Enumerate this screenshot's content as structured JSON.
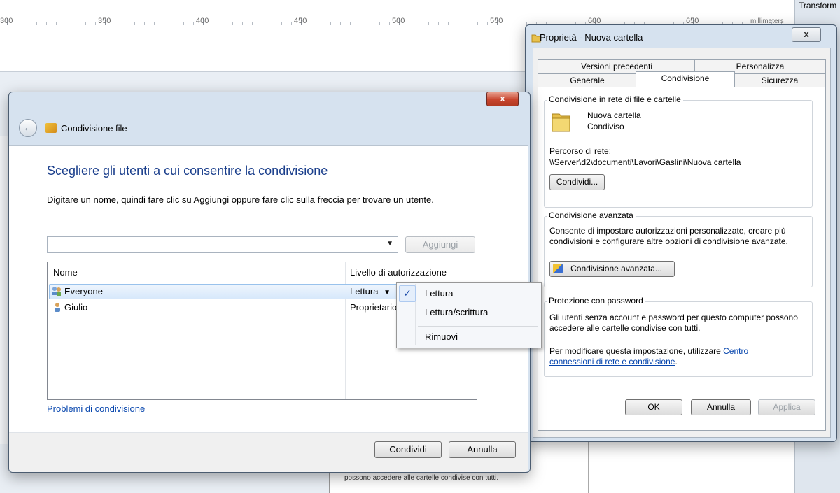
{
  "background": {
    "ruler_numbers": [
      "300",
      "350",
      "400",
      "450",
      "500",
      "550",
      "600",
      "650"
    ],
    "ruler_unit": "millimeters",
    "right_panel_title": "Transform",
    "paper_text": "possono accedere alle cartelle condivise con tutti."
  },
  "share_dialog": {
    "title": "Condivisione file",
    "heading": "Scegliere gli utenti a cui consentire la condivisione",
    "instruction": "Digitare un nome, quindi fare clic su Aggiungi oppure fare clic sulla freccia per trovare un utente.",
    "name_input_value": "",
    "add_button": "Aggiungi",
    "columns": [
      "Nome",
      "Livello di autorizzazione"
    ],
    "rows": [
      {
        "name": "Everyone",
        "permission": "Lettura",
        "has_dropdown": true
      },
      {
        "name": "Giulio",
        "permission": "Proprietario"
      }
    ],
    "problems_link": "Problemi di condivisione",
    "share_button": "Condividi",
    "cancel_button": "Annulla",
    "close_glyph": "x"
  },
  "permission_menu": {
    "items": [
      "Lettura",
      "Lettura/scrittura",
      "Rimuovi"
    ],
    "checked": "Lettura"
  },
  "properties_dialog": {
    "title": "Proprietà - Nuova cartella",
    "tabs_row1": [
      "Versioni precedenti",
      "Personalizza"
    ],
    "tabs_row2": [
      "Generale",
      "Condivisione",
      "Sicurezza"
    ],
    "active_tab": "Condivisione",
    "network_sharing": {
      "group_title": "Condivisione in rete di file e cartelle",
      "folder_name": "Nuova cartella",
      "folder_status": "Condiviso",
      "path_label": "Percorso di rete:",
      "path_value": "\\\\Server\\d2\\documenti\\Lavori\\Gaslini\\Nuova cartella",
      "share_button": "Condividi..."
    },
    "advanced_sharing": {
      "group_title": "Condivisione avanzata",
      "description": "Consente di impostare autorizzazioni personalizzate, creare più condivisioni e configurare altre opzioni di condivisione avanzate.",
      "button": "Condivisione avanzata..."
    },
    "password_protection": {
      "group_title": "Protezione con password",
      "description": "Gli utenti senza account e password per questo computer possono accedere alle cartelle condivise con tutti.",
      "prompt": "Per modificare questa impostazione, utilizzare",
      "link": "Centro connessioni di rete e condivisione",
      "suffix": "."
    },
    "ok_button": "OK",
    "cancel_button": "Annulla",
    "apply_button": "Applica",
    "close_glyph": "x"
  }
}
